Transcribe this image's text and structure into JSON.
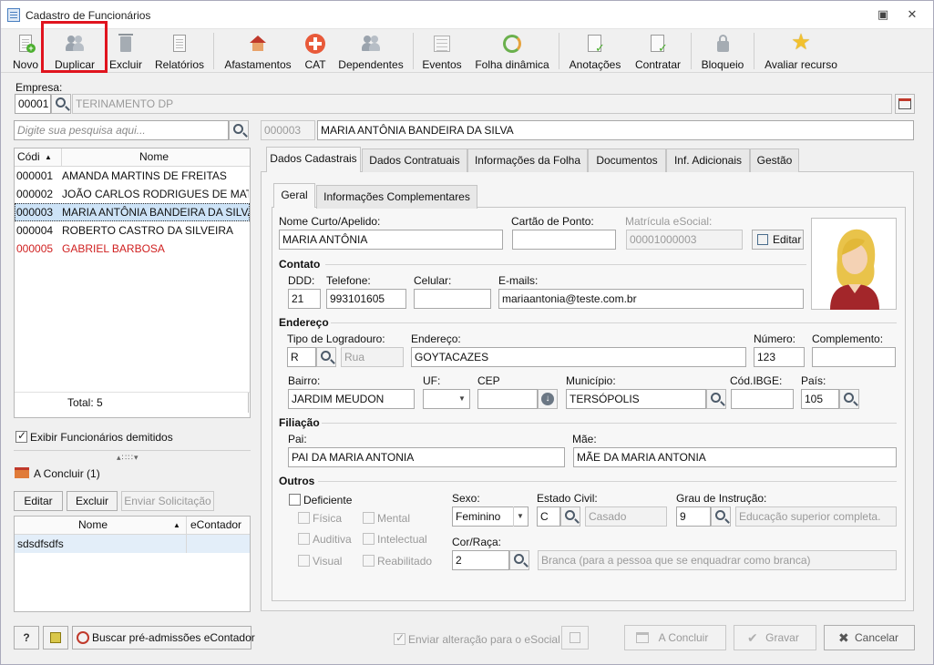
{
  "window": {
    "title": "Cadastro de Funcionários"
  },
  "toolbar": {
    "novo": "Novo",
    "duplicar": "Duplicar",
    "excluir": "Excluir",
    "relatorios": "Relatórios",
    "afastamentos": "Afastamentos",
    "cat": "CAT",
    "dependentes": "Dependentes",
    "eventos": "Eventos",
    "folha_dinamica": "Folha dinâmica",
    "anotacoes": "Anotações",
    "contratar": "Contratar",
    "bloqueio": "Bloqueio",
    "avaliar_recurso": "Avaliar recurso"
  },
  "empresa": {
    "label": "Empresa:",
    "code": "00001",
    "name": "TERINAMENTO DP"
  },
  "search": {
    "placeholder": "Digite sua pesquisa aqui..."
  },
  "selected": {
    "code": "000003",
    "name": "MARIA ANTÔNIA BANDEIRA DA SILVA"
  },
  "employees": {
    "col_code": "Códi",
    "col_name": "Nome",
    "rows": [
      {
        "code": "000001",
        "name": "AMANDA MARTINS DE FREITAS"
      },
      {
        "code": "000002",
        "name": "JOÃO CARLOS RODRIGUES DE MATTOS"
      },
      {
        "code": "000003",
        "name": "MARIA ANTÔNIA BANDEIRA DA SILVA"
      },
      {
        "code": "000004",
        "name": "ROBERTO CASTRO DA SILVEIRA"
      },
      {
        "code": "000005",
        "name": "GABRIEL BARBOSA"
      }
    ],
    "total": "Total: 5"
  },
  "show_dismissed": {
    "label": "Exibir Funcionários demitidos",
    "checked": true
  },
  "pending": {
    "title": "A Concluir (1)",
    "editar": "Editar",
    "excluir": "Excluir",
    "enviar": "Enviar Solicitação",
    "col_name": "Nome",
    "col_econtador": "eContador",
    "rows": [
      {
        "name": "sdsdfsdfs",
        "econtador": ""
      }
    ]
  },
  "bottom": {
    "help": "?",
    "buscar": "Buscar pré-admissões eContador",
    "enviar_esocial": "Enviar alteração para o eSocial",
    "concluir": "A Concluir",
    "gravar": "Gravar",
    "cancelar": "Cancelar"
  },
  "tabs": [
    "Dados Cadastrais",
    "Dados Contratuais",
    "Informações da Folha",
    "Documentos",
    "Inf. Adicionais",
    "Gestão"
  ],
  "subtabs": [
    "Geral",
    "Informações Complementares"
  ],
  "geral": {
    "nome_curto_label": "Nome Curto/Apelido:",
    "nome_curto": "MARIA ANTÔNIA",
    "cartao_label": "Cartão de Ponto:",
    "cartao": "",
    "matricula_label": "Matrícula eSocial:",
    "matricula": "00001000003",
    "editar": "Editar"
  },
  "contato": {
    "title": "Contato",
    "ddd_label": "DDD:",
    "ddd": "21",
    "telefone_label": "Telefone:",
    "telefone": "993101605",
    "celular_label": "Celular:",
    "celular": "",
    "emails_label": "E-mails:",
    "email": "mariaantonia@teste.com.br"
  },
  "endereco": {
    "title": "Endereço",
    "tipo_label": "Tipo de Logradouro:",
    "tipo_code": "R",
    "tipo_name": "Rua",
    "endereco_label": "Endereço:",
    "endereco": "GOYTACAZES",
    "numero_label": "Número:",
    "numero": "123",
    "complemento_label": "Complemento:",
    "complemento": "",
    "bairro_label": "Bairro:",
    "bairro": "JARDIM MEUDON",
    "uf_label": "UF:",
    "uf": "",
    "cep_label": "CEP",
    "cep": "",
    "municipio_label": "Município:",
    "municipio": "TERSÓPOLIS",
    "ibge_label": "Cód.IBGE:",
    "ibge": "",
    "pais_label": "País:",
    "pais": "105"
  },
  "filiacao": {
    "title": "Filiação",
    "pai_label": "Pai:",
    "pai": "PAI DA MARIA ANTONIA",
    "mae_label": "Mãe:",
    "mae": "MÃE DA MARIA ANTONIA"
  },
  "outros": {
    "title": "Outros",
    "deficiente": "Deficiente",
    "fisica": "Física",
    "mental": "Mental",
    "auditiva": "Auditiva",
    "intelectual": "Intelectual",
    "visual": "Visual",
    "reabilitado": "Reabilitado",
    "sexo_label": "Sexo:",
    "sexo": "Feminino",
    "estado_civil_label": "Estado Civil:",
    "estado_civil_code": "C",
    "estado_civil": "Casado",
    "grau_label": "Grau de Instrução:",
    "grau_code": "9",
    "grau": "Educação superior completa.",
    "cor_label": "Cor/Raça:",
    "cor_code": "2",
    "cor": "Branca (para a pessoa que se enquadrar como branca)"
  }
}
